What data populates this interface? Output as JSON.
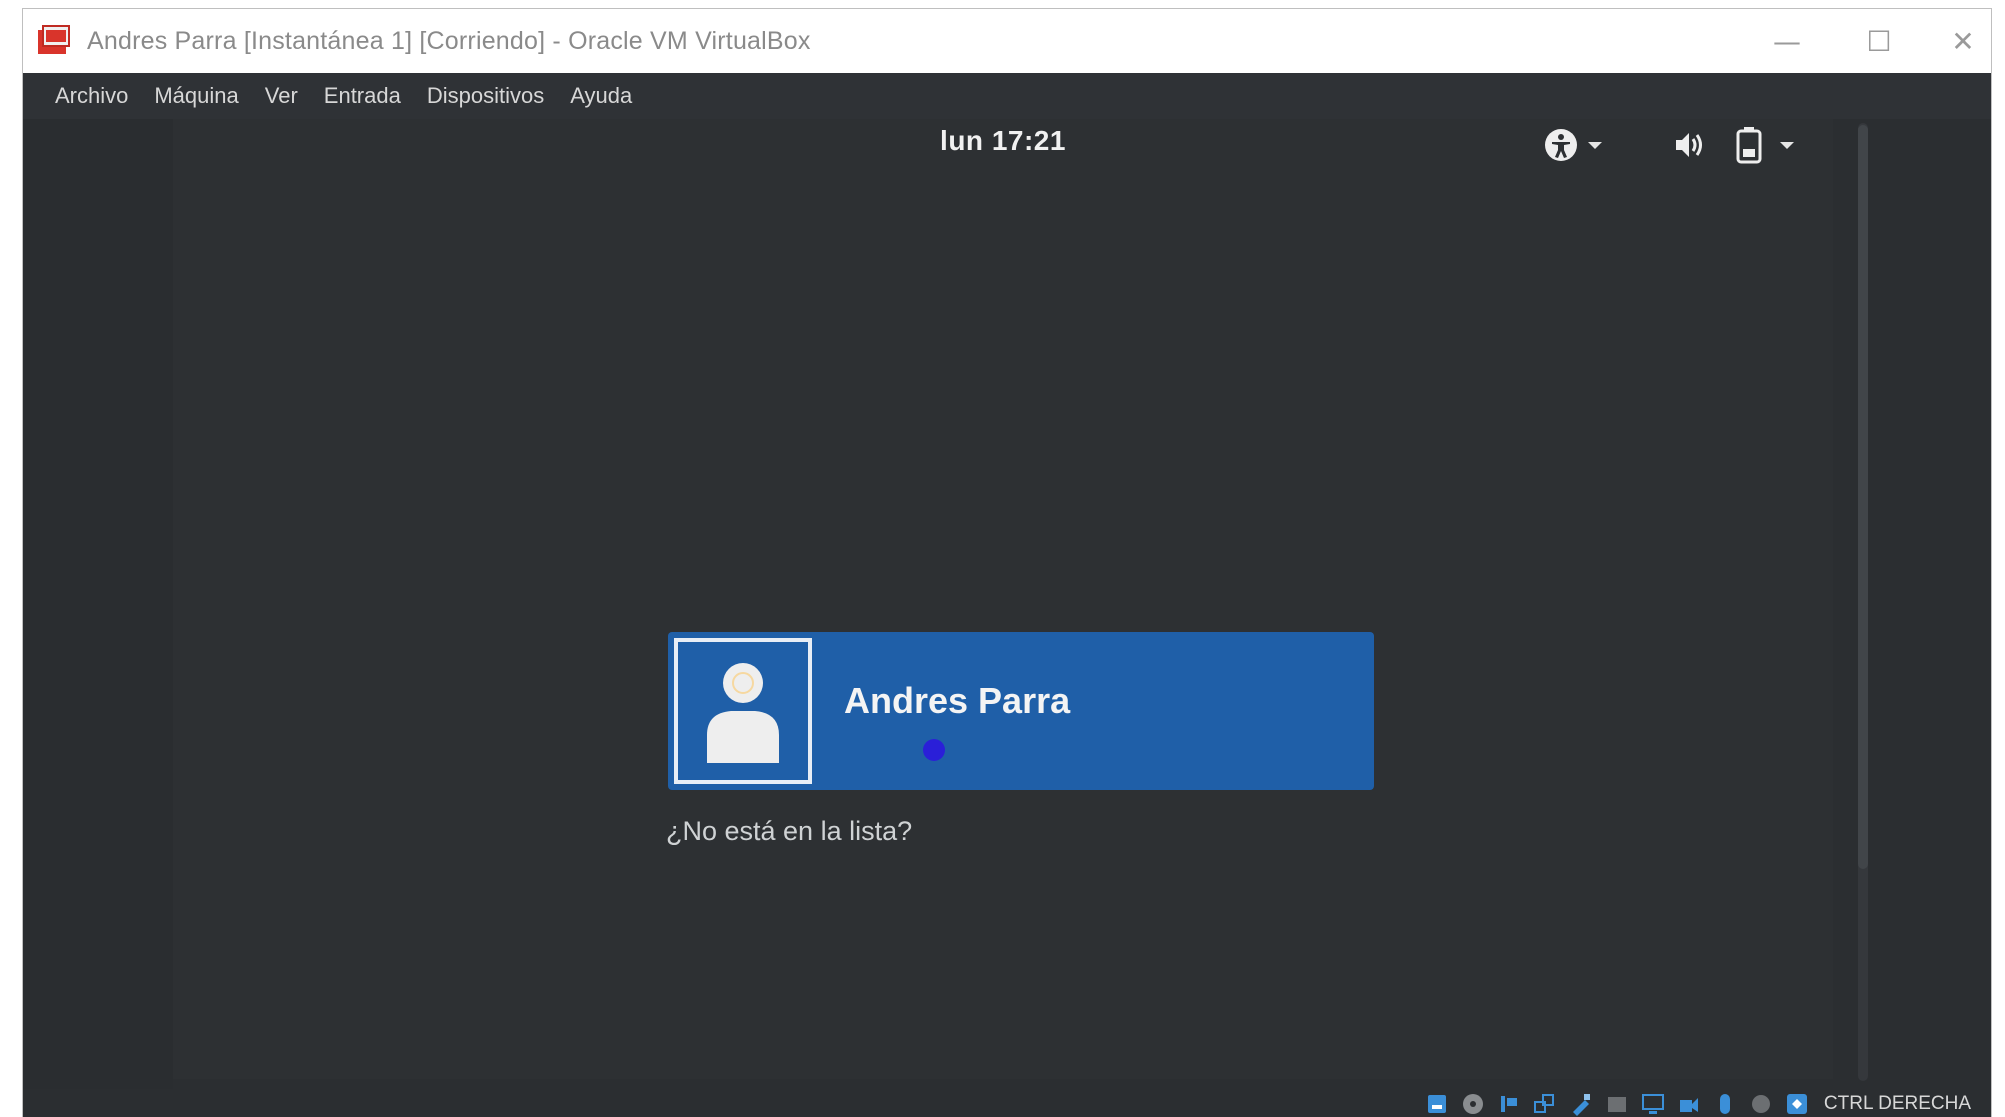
{
  "window": {
    "title": "Andres Parra [Instantánea 1] [Corriendo] - Oracle VM VirtualBox",
    "controls": {
      "minimize": "—",
      "maximize": "☐",
      "close": "✕"
    }
  },
  "menubar": {
    "items": [
      "Archivo",
      "Máquina",
      "Ver",
      "Entrada",
      "Dispositivos",
      "Ayuda"
    ]
  },
  "guest": {
    "clock": "lun 17:21",
    "tray_icons": [
      "accessibility-icon",
      "chevron-down-icon",
      "volume-icon",
      "battery-icon",
      "chevron-down-icon"
    ],
    "user": {
      "name": "Andres Parra",
      "avatar_icon": "user-avatar-icon"
    },
    "not_listed_label": "¿No está en la lista?"
  },
  "statusbar": {
    "icons": [
      "hard-disk-icon",
      "optical-drive-icon",
      "audio-icon",
      "network-icon",
      "usb-icon",
      "shared-folders-icon",
      "display-icon",
      "recording-icon",
      "mouse-integration-icon",
      "cpu-icon",
      "keyboard-capture-icon"
    ],
    "host_key_label": "CTRL DERECHA"
  },
  "colors": {
    "accent": "#1f5fa8",
    "guest_background": "#2d3033",
    "titlebar_background": "#ffffff",
    "logo": "#d9342b"
  }
}
